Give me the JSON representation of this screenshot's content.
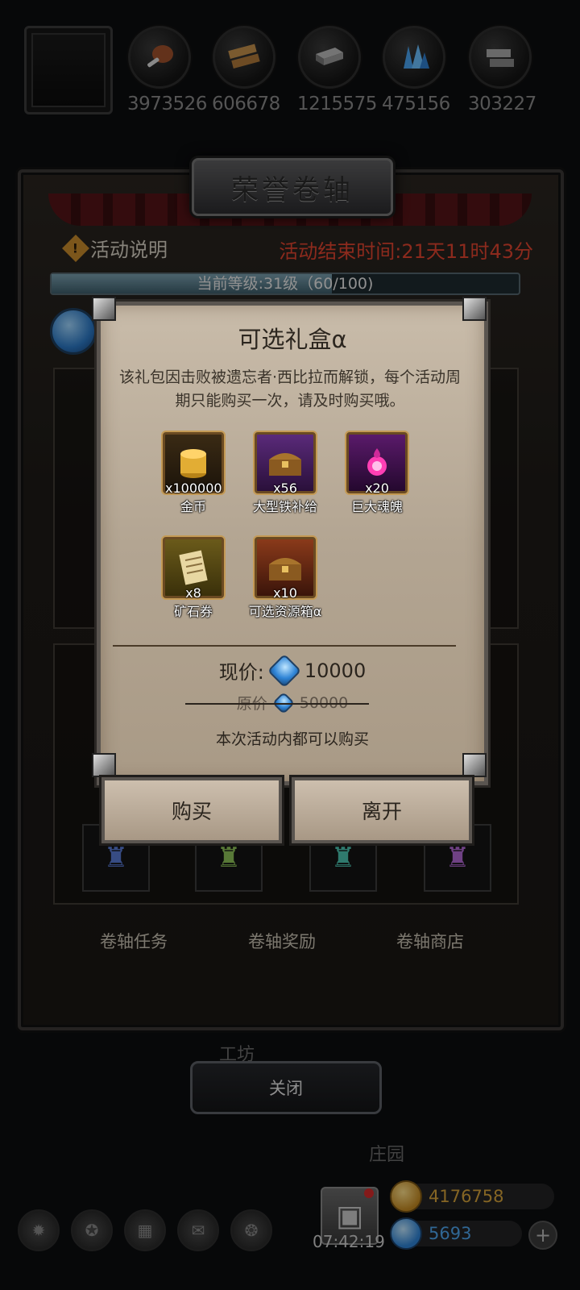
{
  "resources": [
    {
      "icon": "meat-icon",
      "value": "3973526"
    },
    {
      "icon": "wood-icon",
      "value": "606678"
    },
    {
      "icon": "iron-icon",
      "value": "1215575"
    },
    {
      "icon": "crystal-icon",
      "value": "475156"
    },
    {
      "icon": "stone-icon",
      "value": "303227"
    }
  ],
  "panel": {
    "title": "荣誉卷轴",
    "activity_info": "活动说明",
    "end_time": "活动结束时间:21天11时43分",
    "level_text": "当前等级:31级（60/100)",
    "level_progress": 0.6,
    "tabs": [
      "卷轴任务",
      "卷轴奖励",
      "卷轴商店"
    ]
  },
  "dialog": {
    "title": "可选礼盒α",
    "description": "该礼包因击败被遗忘者·西比拉而解锁，每个活动周期只能购买一次，请及时购买哦。",
    "items": [
      {
        "icon": "gold-coin-icon",
        "qty": "x100000",
        "name": "金币"
      },
      {
        "icon": "iron-supply-chest-icon",
        "qty": "x56",
        "name": "大型铁补给"
      },
      {
        "icon": "soul-orb-icon",
        "qty": "x20",
        "name": "巨大魂魄"
      },
      {
        "icon": "ore-voucher-icon",
        "qty": "x8",
        "name": "矿石券"
      },
      {
        "icon": "resource-chest-icon",
        "qty": "x10",
        "name": "可选资源箱α"
      }
    ],
    "price_label": "现价:",
    "price": "10000",
    "original_label": "原价",
    "original_price": "50000",
    "note": "本次活动内都可以购买",
    "buy_label": "购买",
    "leave_label": "离开"
  },
  "close_label": "关闭",
  "background_labels": {
    "workshop": "工坊",
    "manor": "庄园"
  },
  "hud": {
    "clock": "07:42:19",
    "gold": "4176758",
    "gems": "5693"
  },
  "colors": {
    "timer": "#e2452f",
    "gold": "#d7a43a",
    "gem": "#4ea6ef"
  }
}
